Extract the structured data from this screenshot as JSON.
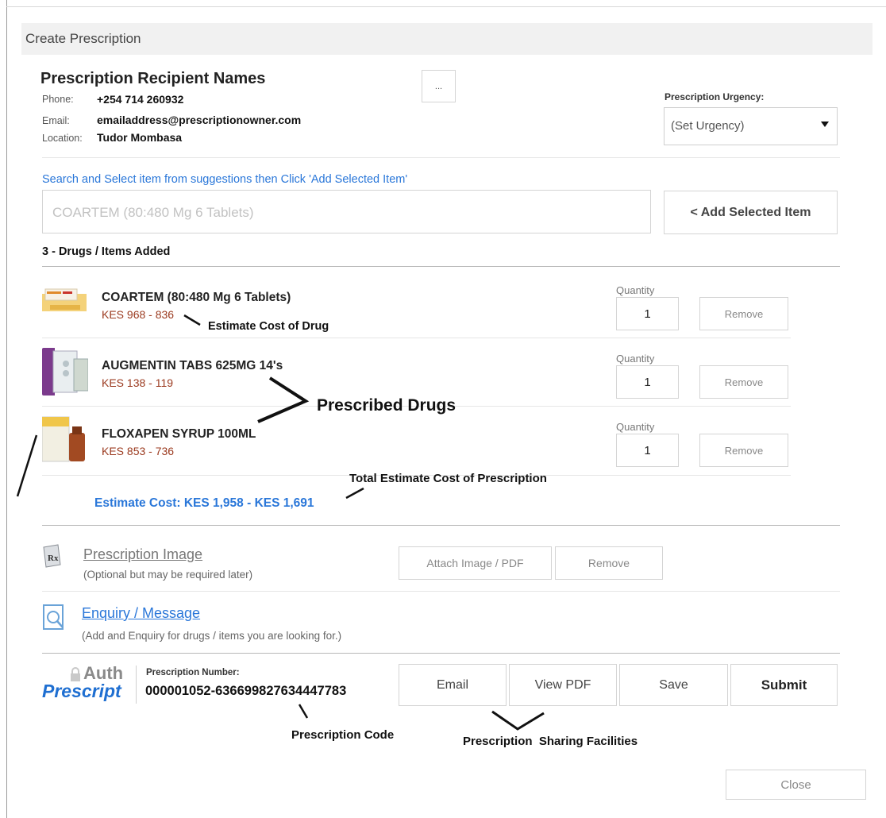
{
  "dialog": {
    "title": "Create Prescription",
    "close_label": "Close"
  },
  "recipient": {
    "name": "Prescription Recipient Names",
    "phone_label": "Phone:",
    "phone": "+254 714 260932",
    "email_label": "Email:",
    "email": "emailaddress@prescriptionowner.com",
    "location_label": "Location:",
    "location": "Tudor Mombasa",
    "more_button": "..."
  },
  "urgency": {
    "label": "Prescription Urgency:",
    "selected": "(Set Urgency)"
  },
  "search": {
    "hint": "Search and Select item from suggestions then Click 'Add Selected Item'",
    "placeholder": "COARTEM  (80:480 Mg 6 Tablets)",
    "add_button": "< Add Selected Item"
  },
  "items": {
    "count_label": "3 - Drugs / Items Added",
    "quantity_label": "Quantity",
    "remove_label": "Remove",
    "list": [
      {
        "name": "COARTEM (80:480 Mg 6 Tablets)",
        "price": "KES 968 - 836",
        "quantity": "1"
      },
      {
        "name": "AUGMENTIN TABS 625MG 14's",
        "price": "KES 138 - 119",
        "quantity": "1"
      },
      {
        "name": "FLOXAPEN SYRUP 100ML",
        "price": "KES 853 - 736",
        "quantity": "1"
      }
    ],
    "total": "Estimate Cost: KES 1,958 - KES 1,691"
  },
  "prescription_image": {
    "title": "Prescription Image",
    "subtitle": "(Optional but may be required later)",
    "attach_button": "Attach Image / PDF",
    "remove_button": "Remove"
  },
  "enquiry": {
    "title": "Enquiry / Message",
    "subtitle": "(Add and Enquiry for drugs / items you are looking for.)"
  },
  "footer": {
    "logo_top": "Auth",
    "logo_bottom": "Prescript",
    "number_label": "Prescription Number:",
    "number": "000001052-636699827634447783",
    "email_button": "Email",
    "view_pdf_button": "View PDF",
    "save_button": "Save",
    "submit_button": "Submit"
  },
  "annotations": {
    "estimate_cost_of_drug": "Estimate Cost of Drug",
    "prescribed_drugs": "Prescribed Drugs",
    "total_estimate": "Total Estimate Cost of Prescription",
    "prescription_code": "Prescription Code",
    "sharing_facilities": "Prescription  Sharing Facilities"
  },
  "colors": {
    "link_blue": "#2a77d9",
    "price_red": "#9b3a1f",
    "header_bg": "#f1f1f1"
  }
}
